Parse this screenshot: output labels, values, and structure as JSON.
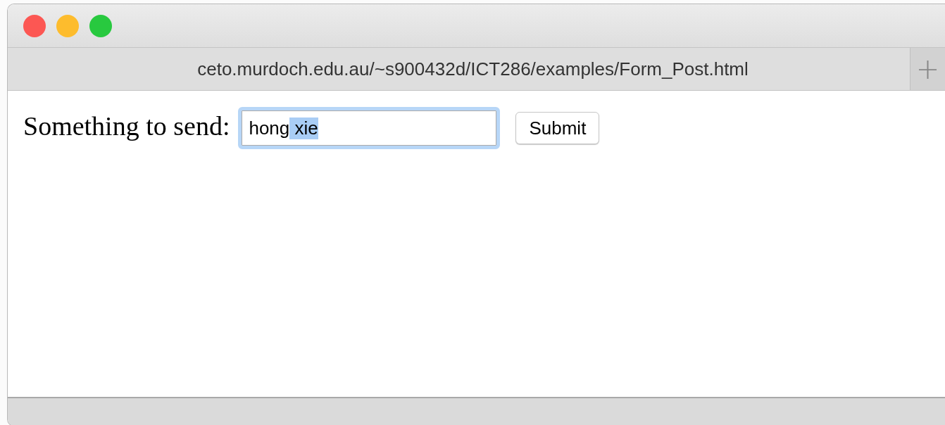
{
  "window": {
    "tab": {
      "title": "ceto.murdoch.edu.au/~s900432d/ICT286/examples/Form_Post.html"
    },
    "new_tab_button": "+"
  },
  "form": {
    "label": "Something to send:",
    "field": {
      "focused": true,
      "value_parts": [
        {
          "text": "hong",
          "selected": false
        },
        {
          "text": " xie",
          "selected": true
        }
      ]
    },
    "button": "Submit"
  }
}
